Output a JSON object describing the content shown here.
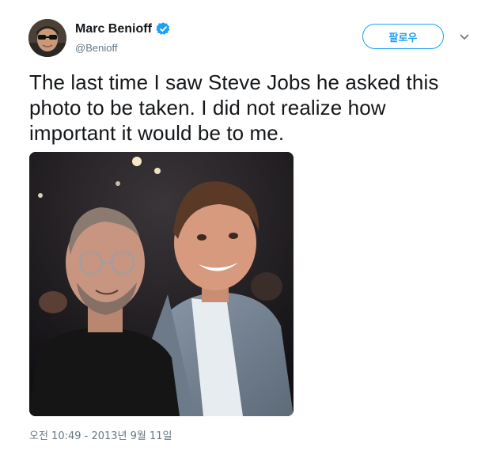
{
  "author": {
    "display_name": "Marc Benioff",
    "handle": "@Benioff",
    "avatar_icon": "user-avatar",
    "verified_icon": "verified-badge-icon",
    "verified_color": "#1da1f2"
  },
  "actions": {
    "follow_label": "팔로우",
    "more_icon": "chevron-down-icon"
  },
  "tweet": {
    "text": "The last time I saw Steve Jobs he asked this photo to be taken. I did not realize how important it would be to me.",
    "timestamp": "오전 10:49 - 2013년 9월 11일"
  },
  "colors": {
    "accent": "#1da1f2",
    "text": "#14171a",
    "muted": "#657786"
  }
}
